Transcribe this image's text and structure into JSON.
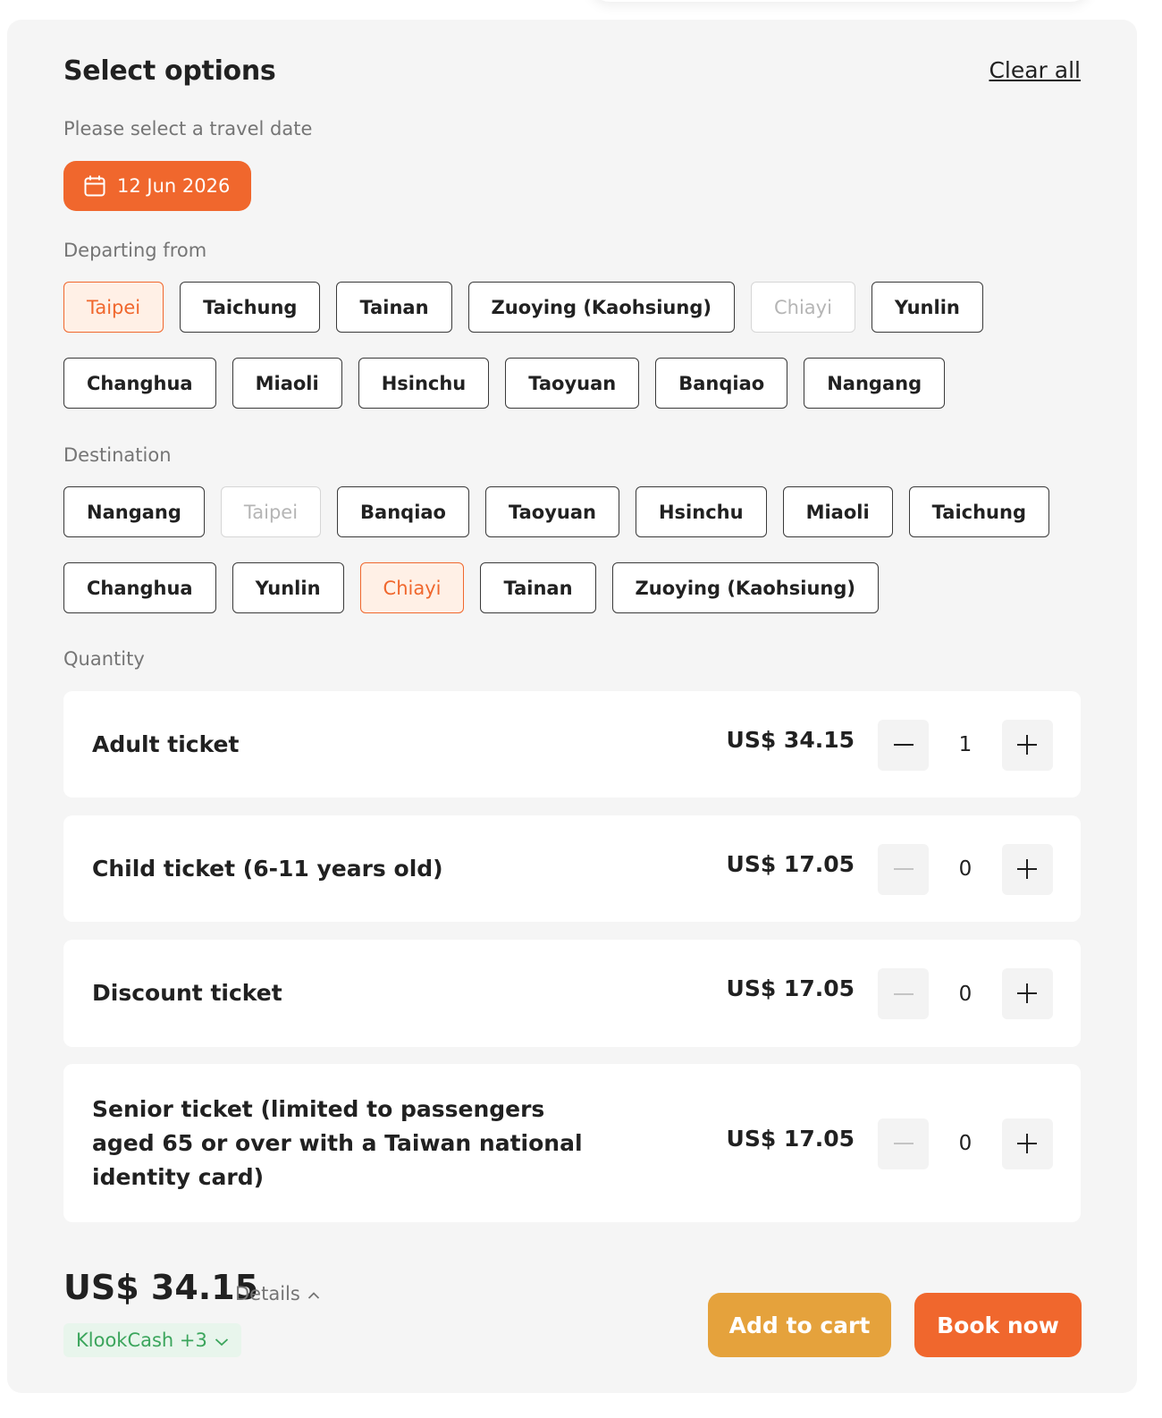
{
  "header": {
    "title": "Select options",
    "clear_all": "Clear all"
  },
  "date_section": {
    "label": "Please select a travel date",
    "selected_date": "12 Jun 2026",
    "icon": "calendar-icon"
  },
  "departing": {
    "label": "Departing from",
    "row1": [
      {
        "label": "Taipei",
        "state": "selected"
      },
      {
        "label": "Taichung",
        "state": "normal"
      },
      {
        "label": "Tainan",
        "state": "normal"
      },
      {
        "label": "Zuoying (Kaohsiung)",
        "state": "normal"
      },
      {
        "label": "Chiayi",
        "state": "disabled"
      },
      {
        "label": "Yunlin",
        "state": "normal"
      }
    ],
    "row2": [
      {
        "label": "Changhua",
        "state": "normal"
      },
      {
        "label": "Miaoli",
        "state": "normal"
      },
      {
        "label": "Hsinchu",
        "state": "normal"
      },
      {
        "label": "Taoyuan",
        "state": "normal"
      },
      {
        "label": "Banqiao",
        "state": "normal"
      },
      {
        "label": "Nangang",
        "state": "normal"
      }
    ]
  },
  "destination": {
    "label": "Destination",
    "row1": [
      {
        "label": "Nangang",
        "state": "normal"
      },
      {
        "label": "Taipei",
        "state": "disabled"
      },
      {
        "label": "Banqiao",
        "state": "normal"
      },
      {
        "label": "Taoyuan",
        "state": "normal"
      },
      {
        "label": "Hsinchu",
        "state": "normal"
      },
      {
        "label": "Miaoli",
        "state": "normal"
      },
      {
        "label": "Taichung",
        "state": "normal"
      }
    ],
    "row2": [
      {
        "label": "Changhua",
        "state": "normal"
      },
      {
        "label": "Yunlin",
        "state": "normal"
      },
      {
        "label": "Chiayi",
        "state": "selected"
      },
      {
        "label": "Tainan",
        "state": "normal"
      },
      {
        "label": "Zuoying (Kaohsiung)",
        "state": "normal"
      }
    ]
  },
  "quantity": {
    "label": "Quantity",
    "tickets": [
      {
        "name": "Adult ticket",
        "price": "US$ 34.15",
        "qty": "1",
        "minus_disabled": false
      },
      {
        "name": "Child ticket (6-11 years old)",
        "price": "US$ 17.05",
        "qty": "0",
        "minus_disabled": true
      },
      {
        "name": "Discount ticket",
        "price": "US$ 17.05",
        "qty": "0",
        "minus_disabled": true
      },
      {
        "name": "Senior ticket (limited to passengers aged 65 or over with a Taiwan national identity card)",
        "price": "US$ 17.05",
        "qty": "0",
        "minus_disabled": true
      }
    ]
  },
  "footer": {
    "total": "US$ 34.15",
    "details": "Details",
    "klookcash": "KlookCash +3",
    "add_to_cart": "Add to cart",
    "book_now": "Book now"
  },
  "colors": {
    "accent": "#f0672d",
    "cart": "#e5a23c",
    "klookcash_green": "#3ba55c"
  }
}
